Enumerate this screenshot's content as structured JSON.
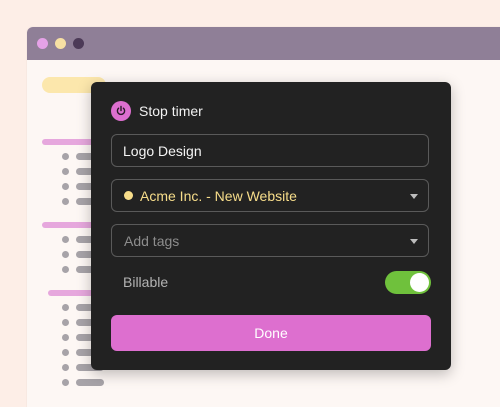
{
  "colors": {
    "accent": "#dd6fcf",
    "project": "#f7dd8a",
    "toggle_on": "#6fc13c",
    "popover_bg": "#222222",
    "titlebar": "#8f7f97"
  },
  "popover": {
    "title": "Stop timer",
    "icon": "power-icon",
    "task": {
      "value": "Logo Design"
    },
    "project": {
      "label": "Acme Inc. - New Website"
    },
    "tags": {
      "placeholder": "Add tags"
    },
    "billable": {
      "label": "Billable",
      "enabled": true
    },
    "done_label": "Done"
  }
}
